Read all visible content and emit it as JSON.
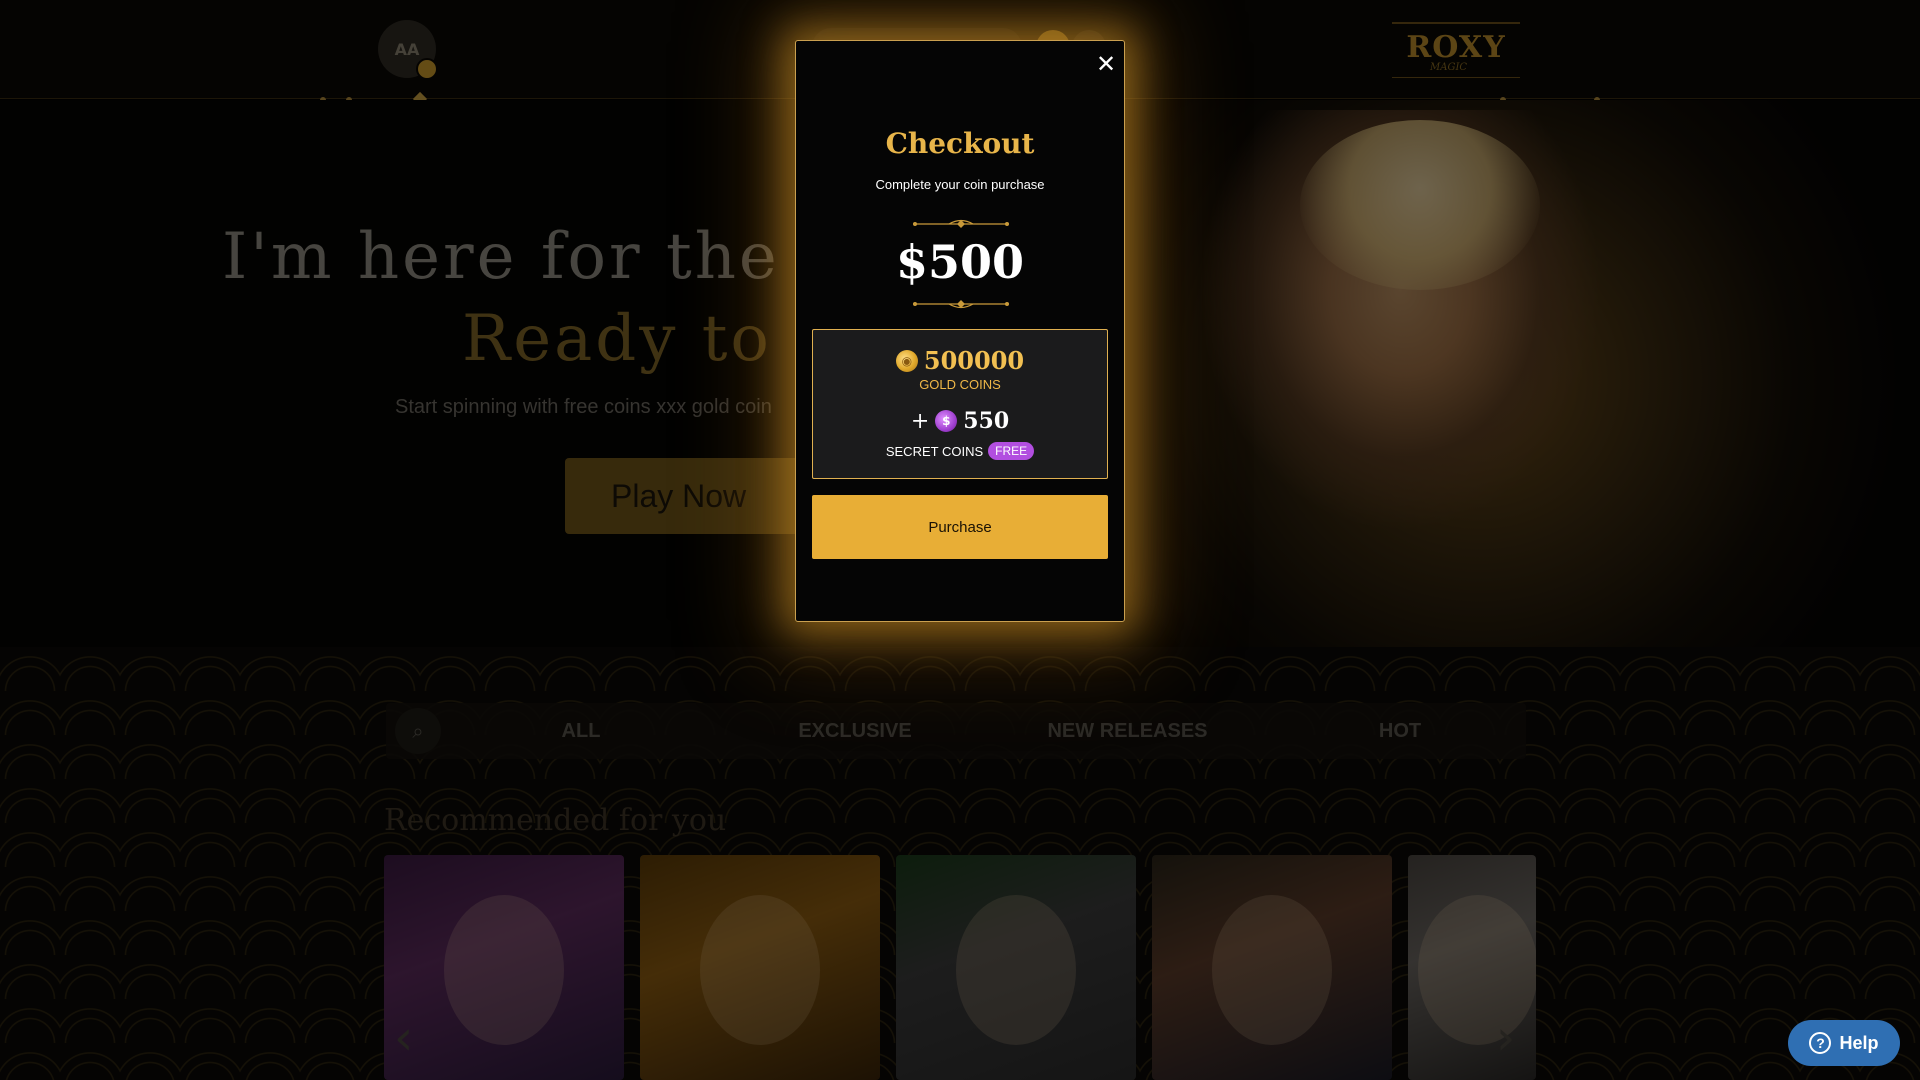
{
  "header": {
    "avatar_initials": "AA",
    "logo_text": "ROXY",
    "logo_sub": "MAGIC"
  },
  "hero": {
    "title_line1": "I'm here for the ga",
    "title_line2": "Ready to pl",
    "subtitle": "Start spinning with free coins xxx gold coin",
    "cta_label": "Play Now"
  },
  "games": {
    "tabs": [
      {
        "label": "ALL"
      },
      {
        "label": "EXCLUSIVE"
      },
      {
        "label": "NEW RELEASES"
      },
      {
        "label": "HOT"
      }
    ],
    "section_title": "Recommended for you"
  },
  "help": {
    "label": "Help",
    "icon_glyph": "?"
  },
  "checkout": {
    "title": "Checkout",
    "subtitle": "Complete your coin purchase",
    "price": "$500",
    "gold_amount": "500000",
    "gold_label": "GOLD COINS",
    "plus": "+",
    "secret_amount": "550",
    "secret_label": "SECRET COINS",
    "free_badge": "FREE",
    "purchase_label": "Purchase",
    "close_glyph": "✕"
  },
  "colors": {
    "accent_gold": "#e8ae36",
    "title_gold": "#e8b54a",
    "free_purple": "#b24ee0",
    "help_blue": "#2f6fb3"
  },
  "icons": {
    "close": "close-icon",
    "gold_coin": "gold-coin-icon",
    "secret_coin": "secret-coin-icon",
    "search": "search-icon",
    "help": "question-icon"
  }
}
